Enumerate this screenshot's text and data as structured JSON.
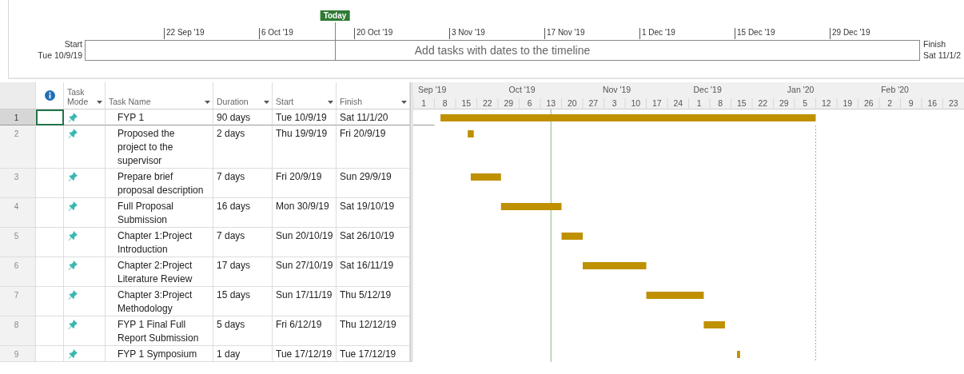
{
  "timeline": {
    "start_label": "Start",
    "start_date": "Tue 10/9/19",
    "finish_label": "Finish",
    "finish_date": "Sat 11/1/2",
    "today_label": "Today",
    "placeholder": "Add tasks with dates to the timeline",
    "ticks": [
      "22 Sep '19",
      "6 Oct '19",
      "20 Oct '19",
      "3 Nov '19",
      "17 Nov '19",
      "1 Dec '19",
      "15 Dec '19",
      "29 Dec '19"
    ]
  },
  "table": {
    "columns": [
      {
        "label": "Task\nMode"
      },
      {
        "label": "Task Name"
      },
      {
        "label": "Duration"
      },
      {
        "label": "Start"
      },
      {
        "label": "Finish"
      }
    ],
    "rows": [
      {
        "id": "1",
        "name": "FYP 1",
        "duration": "90 days",
        "start": "Tue 10/9/19",
        "finish": "Sat 11/1/20",
        "selected": true
      },
      {
        "id": "2",
        "name": "Proposed the\nproject to the\nsupervisor",
        "duration": "2 days",
        "start": "Thu 19/9/19",
        "finish": "Fri 20/9/19",
        "selected": false
      },
      {
        "id": "3",
        "name": "Prepare brief\nproposal description",
        "duration": "7 days",
        "start": "Fri 20/9/19",
        "finish": "Sun 29/9/19",
        "selected": false
      },
      {
        "id": "4",
        "name": "Full Proposal\nSubmission",
        "duration": "16 days",
        "start": "Mon 30/9/19",
        "finish": "Sat 19/10/19",
        "selected": false
      },
      {
        "id": "5",
        "name": "Chapter 1:Project\nIntroduction",
        "duration": "7 days",
        "start": "Sun 20/10/19",
        "finish": "Sat 26/10/19",
        "selected": false
      },
      {
        "id": "6",
        "name": "Chapter 2:Project\nLiterature Review",
        "duration": "17 days",
        "start": "Sun 27/10/19",
        "finish": "Sat 16/11/19",
        "selected": false
      },
      {
        "id": "7",
        "name": "Chapter 3:Project\nMethodology",
        "duration": "15 days",
        "start": "Sun 17/11/19",
        "finish": "Thu 5/12/19",
        "selected": false
      },
      {
        "id": "8",
        "name": "FYP 1 Final Full\nReport Submission",
        "duration": "5 days",
        "start": "Fri 6/12/19",
        "finish": "Thu 12/12/19",
        "selected": false
      },
      {
        "id": "9",
        "name": "FYP 1 Symposium",
        "duration": "1 day",
        "start": "Tue 17/12/19",
        "finish": "Tue 17/12/19",
        "selected": false
      }
    ]
  },
  "gantt": {
    "months": [
      "Sep '19",
      "Oct '19",
      "Nov '19",
      "Dec '19",
      "Jan '20",
      "Feb '20"
    ],
    "weeks": [
      "1",
      "8",
      "15",
      "22",
      "29",
      "6",
      "13",
      "20",
      "27",
      "3",
      "10",
      "17",
      "24",
      "1",
      "8",
      "15",
      "22",
      "29",
      "5",
      "12",
      "19",
      "26",
      "2",
      "9",
      "16",
      "23"
    ],
    "kind": "picture"
  }
}
